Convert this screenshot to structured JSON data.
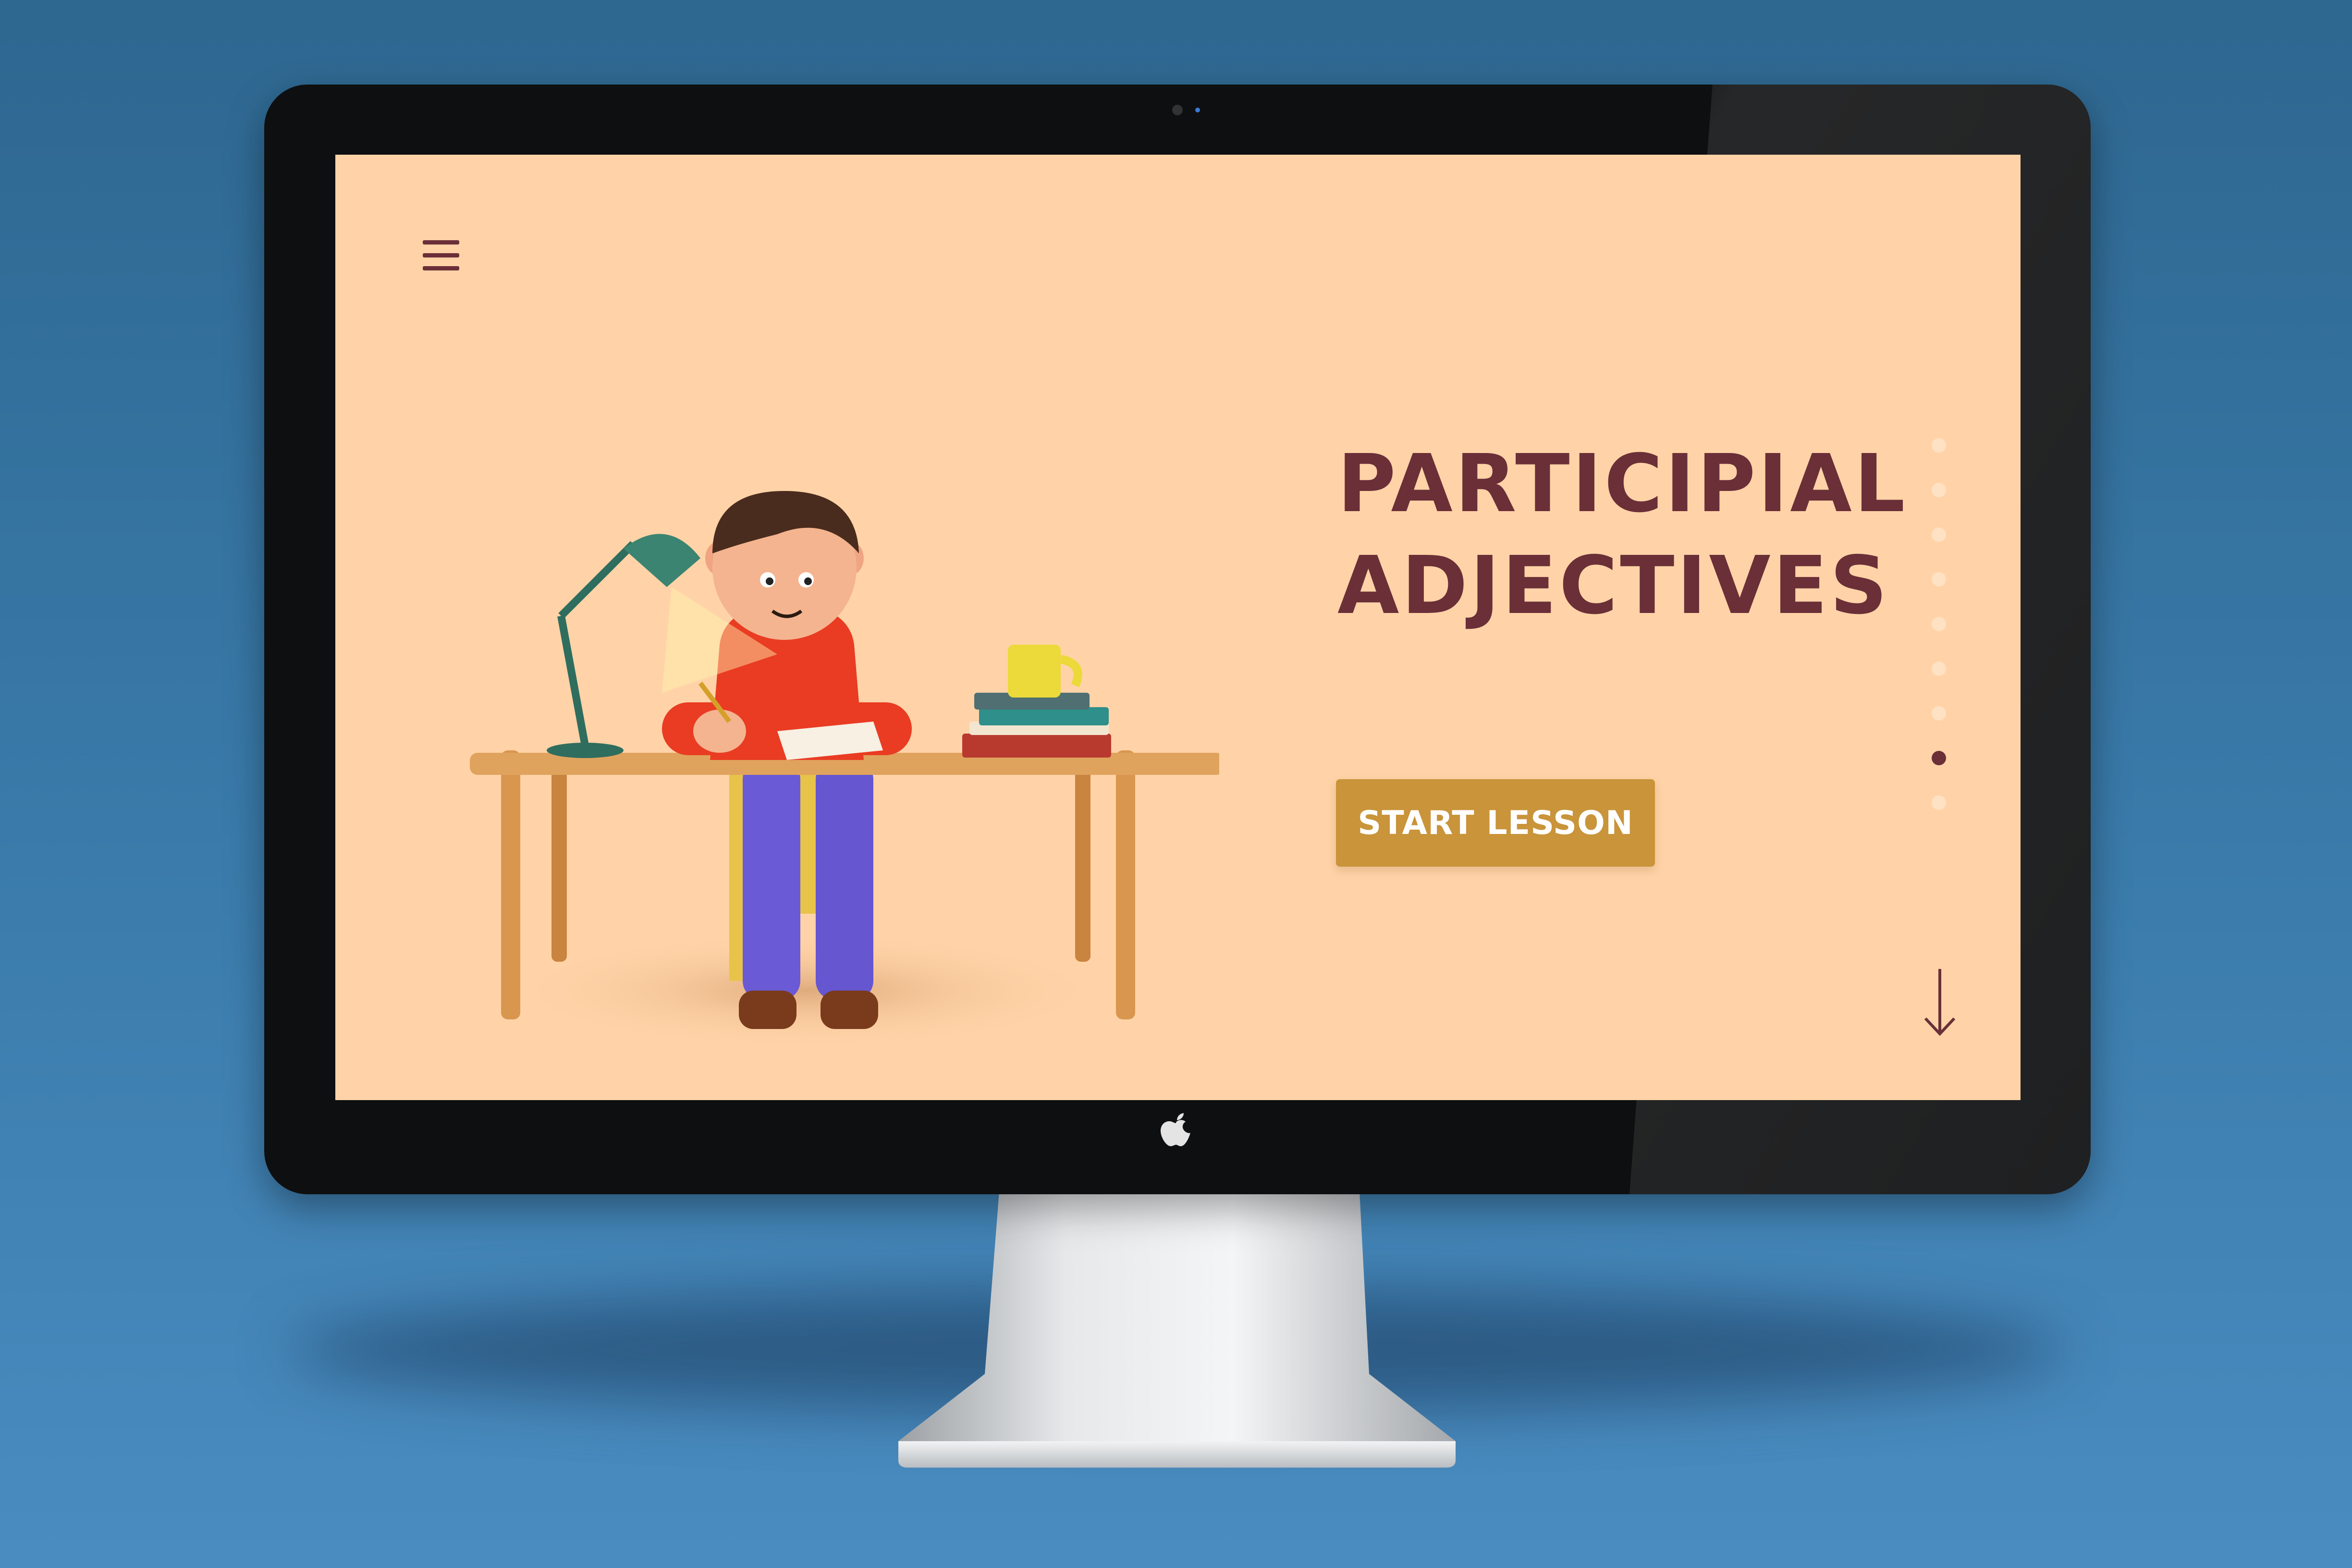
{
  "lesson": {
    "title_line1": "PARTICIPIAL",
    "title_line2": "ADJECTIVES",
    "start_button_label": "START LESSON"
  },
  "navigation": {
    "menu_icon": "hamburger-menu-icon",
    "pagination_dots": 9,
    "active_dot_index": 7,
    "scroll_icon": "arrow-down-icon"
  },
  "colors": {
    "screen_background": "#ffd3a7",
    "title_color": "#6b2f38",
    "button_color": "#c9943a",
    "button_text": "#ffffff",
    "inactive_dot": "#ffe1c3",
    "active_dot": "#6b2f38",
    "backdrop": "#3a7bab"
  }
}
